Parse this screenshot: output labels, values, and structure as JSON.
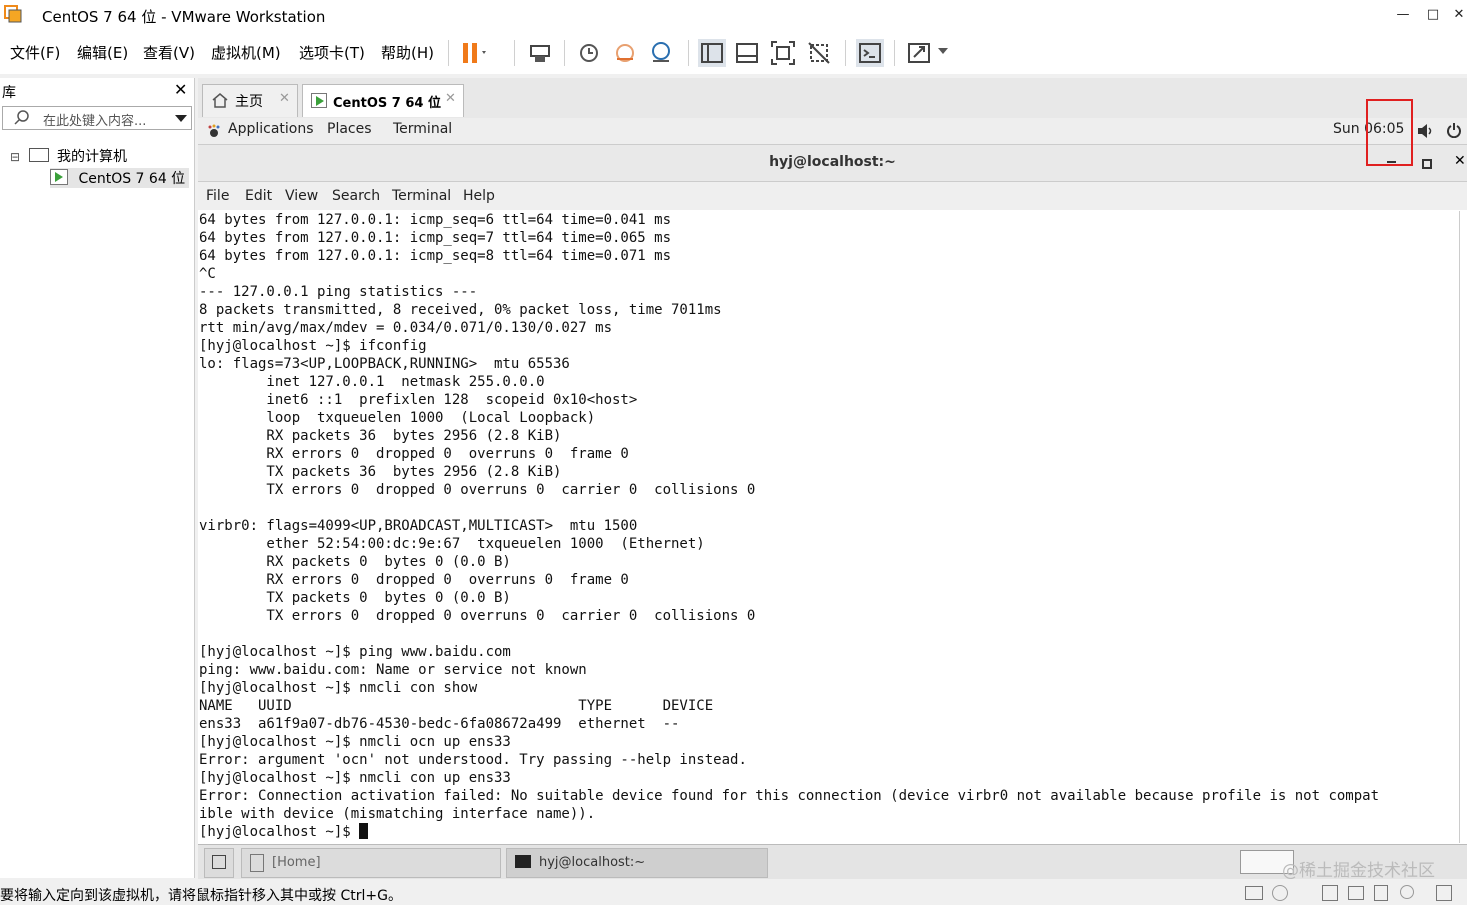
{
  "window": {
    "title": "CentOS 7 64 位 - VMware Workstation",
    "min": "—",
    "max": "□",
    "close": "✕"
  },
  "menubar": [
    "文件(F)",
    "编辑(E)",
    "查看(V)",
    "虚拟机(M)",
    "选项卡(T)",
    "帮助(H)"
  ],
  "library": {
    "title": "库",
    "close": "✕",
    "search_placeholder": "在此处键入内容...",
    "tree_root": "我的计算机",
    "tree_vm": "CentOS 7 64 位",
    "expander": "⊟"
  },
  "tabs": {
    "home": "主页",
    "vm": "CentOS 7 64 位",
    "close": "✕"
  },
  "gnome": {
    "applications": "Applications",
    "places": "Places",
    "terminal": "Terminal",
    "clock": "Sun 06:05"
  },
  "terminal": {
    "title": "hyj@localhost:~",
    "menu": [
      "File",
      "Edit",
      "View",
      "Search",
      "Terminal",
      "Help"
    ],
    "lines": [
      "64 bytes from 127.0.0.1: icmp_seq=6 ttl=64 time=0.041 ms",
      "64 bytes from 127.0.0.1: icmp_seq=7 ttl=64 time=0.065 ms",
      "64 bytes from 127.0.0.1: icmp_seq=8 ttl=64 time=0.071 ms",
      "^C",
      "--- 127.0.0.1 ping statistics ---",
      "8 packets transmitted, 8 received, 0% packet loss, time 7011ms",
      "rtt min/avg/max/mdev = 0.034/0.071/0.130/0.027 ms",
      "[hyj@localhost ~]$ ifconfig",
      "lo: flags=73<UP,LOOPBACK,RUNNING>  mtu 65536",
      "        inet 127.0.0.1  netmask 255.0.0.0",
      "        inet6 ::1  prefixlen 128  scopeid 0x10<host>",
      "        loop  txqueuelen 1000  (Local Loopback)",
      "        RX packets 36  bytes 2956 (2.8 KiB)",
      "        RX errors 0  dropped 0  overruns 0  frame 0",
      "        TX packets 36  bytes 2956 (2.8 KiB)",
      "        TX errors 0  dropped 0 overruns 0  carrier 0  collisions 0",
      "",
      "virbr0: flags=4099<UP,BROADCAST,MULTICAST>  mtu 1500",
      "        ether 52:54:00:dc:9e:67  txqueuelen 1000  (Ethernet)",
      "        RX packets 0  bytes 0 (0.0 B)",
      "        RX errors 0  dropped 0  overruns 0  frame 0",
      "        TX packets 0  bytes 0 (0.0 B)",
      "        TX errors 0  dropped 0 overruns 0  carrier 0  collisions 0",
      "",
      "[hyj@localhost ~]$ ping www.baidu.com",
      "ping: www.baidu.com: Name or service not known",
      "[hyj@localhost ~]$ nmcli con show",
      "NAME   UUID                                  TYPE      DEVICE",
      "ens33  a61f9a07-db76-4530-bedc-6fa08672a499  ethernet  --",
      "[hyj@localhost ~]$ nmcli ocn up ens33",
      "Error: argument 'ocn' not understood. Try passing --help instead.",
      "[hyj@localhost ~]$ nmcli con up ens33",
      "Error: Connection activation failed: No suitable device found for this connection (device virbr0 not available because profile is not compat",
      "ible with device (mismatching interface name))."
    ],
    "prompt": "[hyj@localhost ~]$ "
  },
  "taskbar": {
    "home": "[Home]",
    "term": "hyj@localhost:~"
  },
  "status": "要将输入定向到该虚拟机，请将鼠标指针移入其中或按 Ctrl+G。",
  "watermark": "@稀土掘金技术社区",
  "colors": {
    "highlight_box": "#e02020",
    "pause_orange": "#f07a1a"
  }
}
